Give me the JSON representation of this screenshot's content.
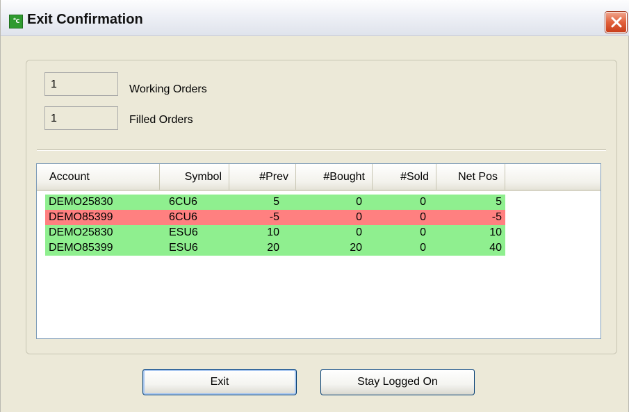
{
  "window": {
    "title": "Exit Confirmation",
    "icon": "app-logo-icon",
    "icon_text": "°c"
  },
  "summary": {
    "working_orders_count": "1",
    "working_orders_label": "Working Orders",
    "filled_orders_count": "1",
    "filled_orders_label": "Filled Orders"
  },
  "table": {
    "columns": [
      "Account",
      "Symbol",
      "#Prev",
      "#Bought",
      "#Sold",
      "Net Pos"
    ],
    "rows": [
      {
        "account": "DEMO25830",
        "symbol": "6CU6",
        "prev": "5",
        "bought": "0",
        "sold": "0",
        "net": "5",
        "status": "green"
      },
      {
        "account": "DEMO85399",
        "symbol": "6CU6",
        "prev": "-5",
        "bought": "0",
        "sold": "0",
        "net": "-5",
        "status": "red"
      },
      {
        "account": "DEMO25830",
        "symbol": "ESU6",
        "prev": "10",
        "bought": "0",
        "sold": "0",
        "net": "10",
        "status": "green"
      },
      {
        "account": "DEMO85399",
        "symbol": "ESU6",
        "prev": "20",
        "bought": "20",
        "sold": "0",
        "net": "40",
        "status": "green"
      }
    ]
  },
  "buttons": {
    "exit_label": "Exit",
    "stay_label": "Stay Logged On"
  },
  "colors": {
    "row_green": "#8fef8f",
    "row_red": "#ff8080",
    "close_button": "#e2613c"
  }
}
